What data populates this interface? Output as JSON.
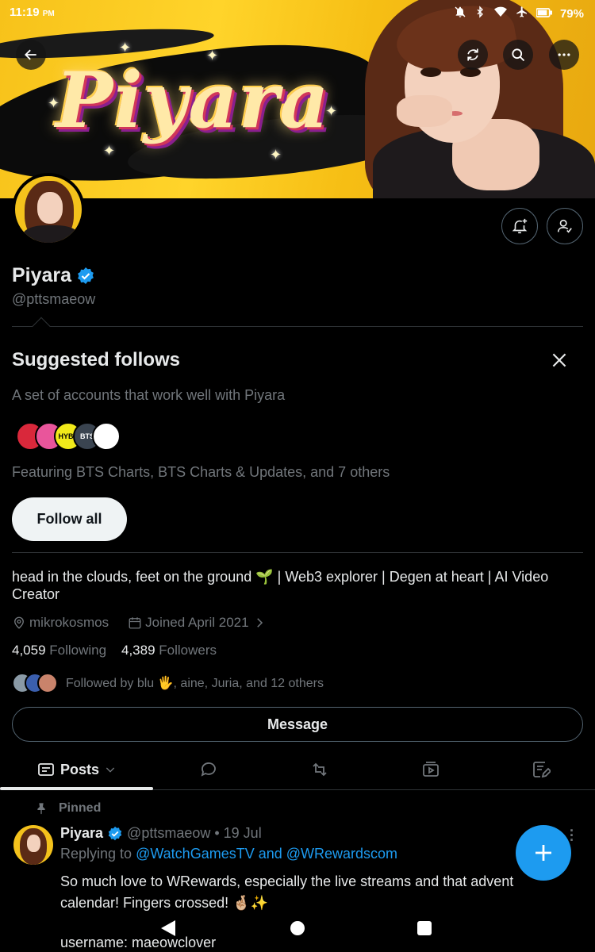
{
  "status_bar": {
    "time": "11:19",
    "ampm": "PM",
    "battery": "79%",
    "icons": [
      "mute-icon",
      "bluetooth-icon",
      "wifi-icon",
      "airplane-icon",
      "battery-icon"
    ]
  },
  "banner": {
    "logo_text": "Piyara"
  },
  "header_buttons": {
    "back": "back-arrow-icon",
    "refresh": "refresh-icon",
    "search": "search-icon",
    "more": "more-icon"
  },
  "profile": {
    "name": "Piyara",
    "verified": true,
    "handle": "@pttsmaeow",
    "bio": "head in the clouds, feet on the ground 🌱 | Web3 explorer | Degen at heart | AI Video Creator",
    "location": "mikrokosmos",
    "joined": "Joined April 2021",
    "following_count": "4,059",
    "following_label": "Following",
    "followers_count": "4,389",
    "followers_label": "Followers",
    "followed_by": "Followed by blu 🖐️, aine, Juria, and 12 others",
    "message_label": "Message"
  },
  "suggested": {
    "title": "Suggested follows",
    "subtitle": "A set of accounts that work well with Piyara",
    "featuring": "Featuring BTS Charts, BTS Charts & Updates, and 7 others",
    "follow_all_label": "Follow all",
    "avatars": [
      {
        "text": "",
        "color": "#d9283b"
      },
      {
        "text": "",
        "color": "#e9559b"
      },
      {
        "text": "HYBE",
        "color": "#f1ea1a"
      },
      {
        "text": "BTS",
        "color": "#3a4450"
      },
      {
        "text": "",
        "color": "#ffffff"
      }
    ]
  },
  "tabs": {
    "posts_label": "Posts",
    "items": [
      "posts-icon",
      "replies-icon",
      "reposts-icon",
      "media-icon",
      "articles-icon"
    ]
  },
  "post": {
    "pinned_label": "Pinned",
    "name": "Piyara",
    "handle": "@pttsmaeow",
    "date": "• 19 Jul",
    "replying_prefix": "Replying to",
    "replying_to": "@WatchGamesTV and @WRewardscom",
    "text": "So much love to WRewards, especially the live streams and that advent calendar! Fingers crossed! 🤞🏼✨",
    "text2": "username: maeowclover"
  },
  "colors": {
    "accent": "#1d9bf0",
    "background": "#000000",
    "muted": "#71767b",
    "banner": "#ffd42a"
  }
}
